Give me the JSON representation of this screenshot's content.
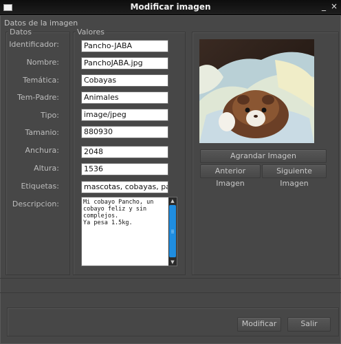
{
  "window": {
    "title": "Modificar imagen",
    "minimize_glyph": "_",
    "close_glyph": "×"
  },
  "group_title": "Datos de la imagen",
  "legends": {
    "datos": "Datos",
    "valores": "Valores"
  },
  "fields": [
    {
      "label": "Identificador:",
      "value": "Pancho-JABA"
    },
    {
      "label": "Nombre:",
      "value": "PanchoJABA.jpg"
    },
    {
      "label": "Temática:",
      "value": "Cobayas"
    },
    {
      "label": "Tem-Padre:",
      "value": "Animales"
    },
    {
      "label": "Tipo:",
      "value": "image/jpeg"
    },
    {
      "label": "Tamanio:",
      "value": "880930"
    },
    {
      "label": "Anchura:",
      "value": "2048"
    },
    {
      "label": "Altura:",
      "value": "1536"
    },
    {
      "label": "Etiquetas:",
      "value": "mascotas, cobayas, panc"
    }
  ],
  "descripcion": {
    "label": "Descripcion:",
    "value": "Mi cobayo Pancho, un cobayo feliz y sin complejos.\nYa pesa 1.5kg."
  },
  "buttons": {
    "agrandar": "Agrandar Imagen",
    "anterior": "Anterior Imagen",
    "siguiente": "Siguiente Imagen",
    "modificar": "Modificar",
    "salir": "Salir"
  }
}
